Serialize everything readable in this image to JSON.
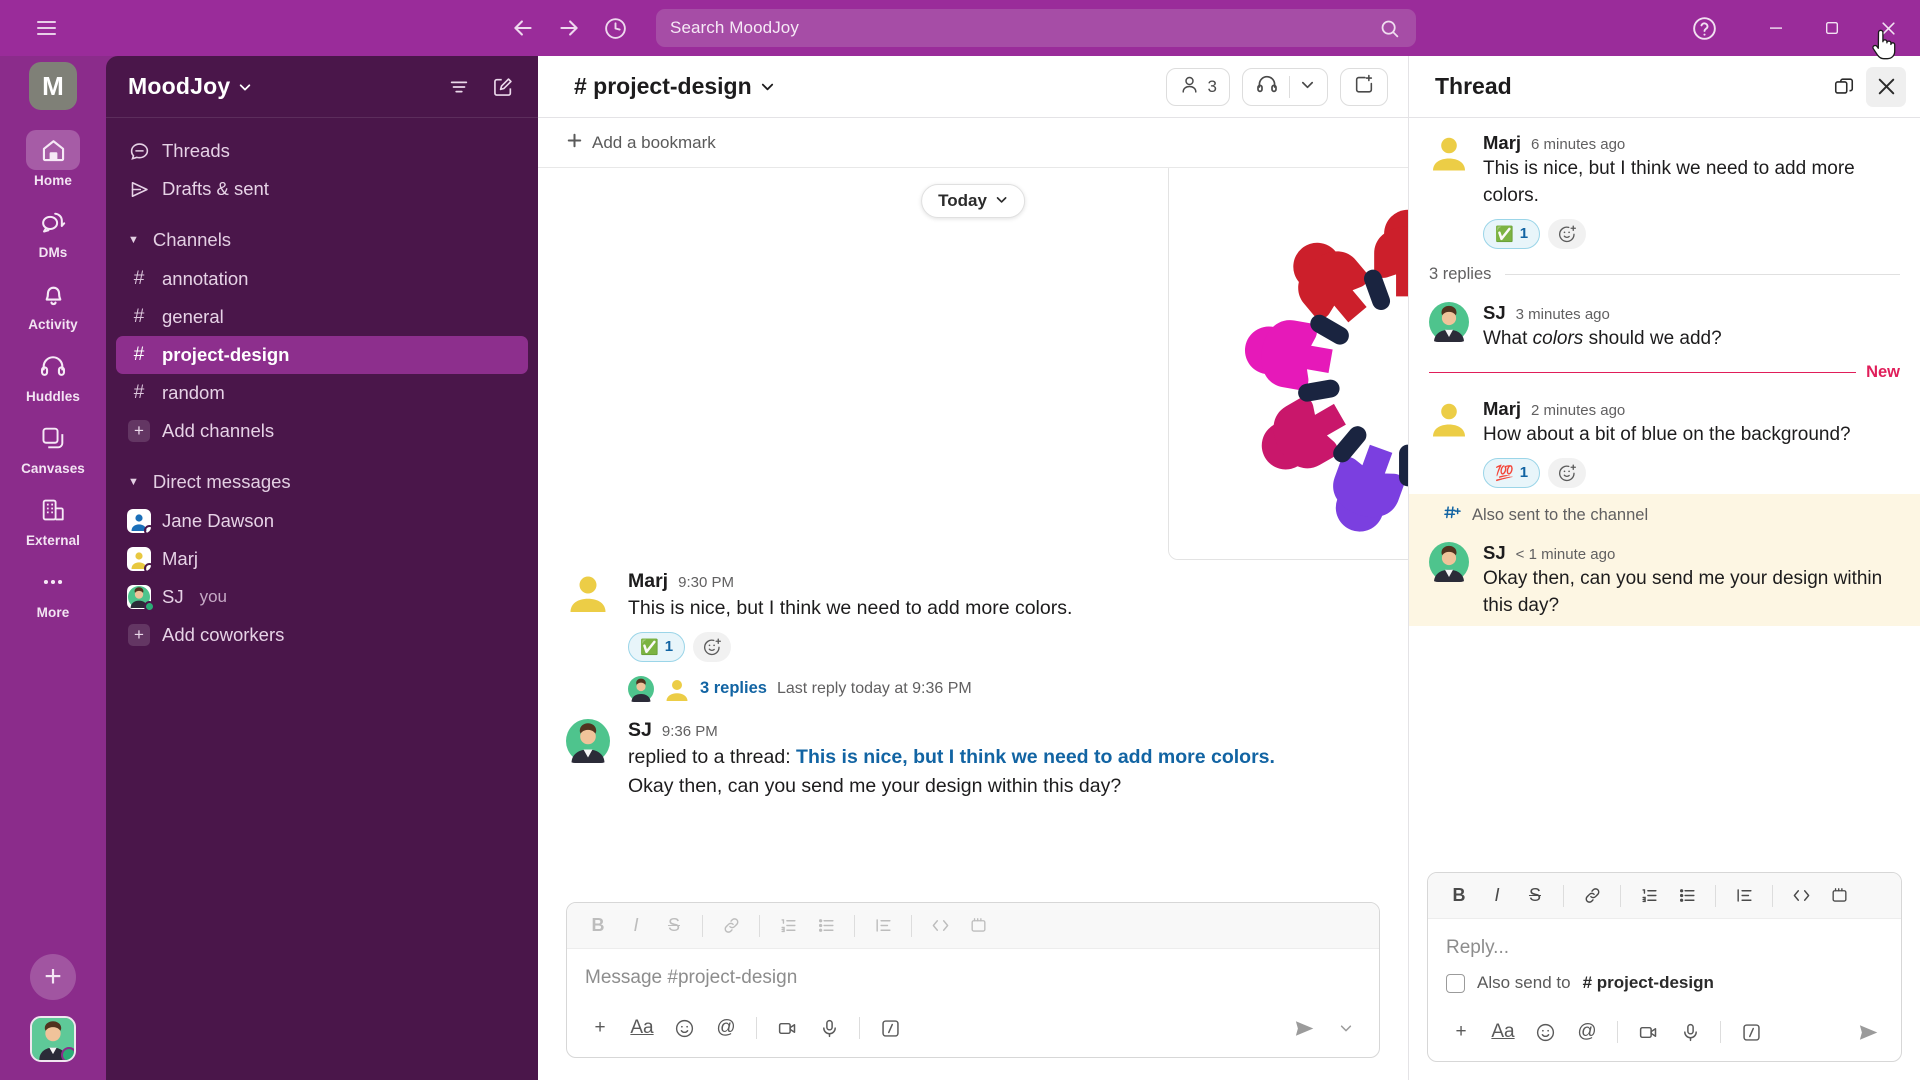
{
  "titlebar": {
    "hamburger_icon": "hamburger-menu-icon",
    "back_icon": "arrow-back-icon",
    "forward_icon": "arrow-forward-icon",
    "history_icon": "clock-history-icon",
    "search_placeholder": "Search MoodJoy",
    "search_icon": "search-magnifier-icon",
    "help_icon": "help-circle-icon",
    "minimize_icon": "window-minimize-icon",
    "maximize_icon": "window-maximize-icon",
    "close_icon": "window-close-icon"
  },
  "rail": {
    "workspace_initial": "M",
    "items": [
      {
        "label": "Home",
        "icon": "home-icon",
        "active": true
      },
      {
        "label": "DMs",
        "icon": "dms-bubble-icon",
        "active": false
      },
      {
        "label": "Activity",
        "icon": "bell-icon",
        "active": false
      },
      {
        "label": "Huddles",
        "icon": "headphones-icon",
        "active": false
      },
      {
        "label": "Canvases",
        "icon": "canvas-pages-icon",
        "active": false
      },
      {
        "label": "External",
        "icon": "building-icon",
        "active": false
      },
      {
        "label": "More",
        "icon": "ellipsis-icon",
        "active": false
      }
    ],
    "new_button_icon": "plus-icon",
    "avatar_name": "user-avatar"
  },
  "sidebar": {
    "workspace_name": "MoodJoy",
    "workspace_caret_icon": "chevron-down-icon",
    "filter_icon": "filter-lines-icon",
    "compose_icon": "compose-pencil-icon",
    "top_items": [
      {
        "label": "Threads",
        "icon": "threads-bubble-icon"
      },
      {
        "label": "Drafts & sent",
        "icon": "paper-plane-icon"
      }
    ],
    "channels_section": {
      "label": "Channels",
      "caret_icon": "caret-down-icon",
      "items": [
        {
          "label": "annotation",
          "active": false
        },
        {
          "label": "general",
          "active": false
        },
        {
          "label": "project-design",
          "active": true
        },
        {
          "label": "random",
          "active": false
        }
      ],
      "add_label": "Add channels",
      "add_icon": "plus-icon"
    },
    "dm_section": {
      "label": "Direct messages",
      "caret_icon": "caret-down-icon",
      "items": [
        {
          "label": "Jane Dawson",
          "suffix": "",
          "presence": "offline",
          "avatar_color": "#1b6fb8"
        },
        {
          "label": "Marj",
          "suffix": "",
          "presence": "offline",
          "avatar_color": "#e8c840"
        },
        {
          "label": "SJ",
          "suffix": "you",
          "presence": "online",
          "avatar_color": "#4ec48d"
        }
      ],
      "add_label": "Add coworkers",
      "add_icon": "plus-icon"
    }
  },
  "channel": {
    "name": "# project-design",
    "caret_icon": "chevron-down-icon",
    "members_count": "3",
    "members_icon": "person-icon",
    "huddle_icon": "headphones-icon",
    "huddle_caret_icon": "chevron-down-icon",
    "new_canvas_icon": "add-canvas-icon",
    "bookmark_label": "Add a bookmark",
    "bookmark_icon": "plus-icon",
    "date_chip": "Today",
    "date_chip_caret_icon": "chevron-down-icon",
    "attachment_alt": "circle-of-colorful-people-illustration",
    "messages": [
      {
        "author": "Marj",
        "time": "9:30 PM",
        "avatar_color": "#e8c840",
        "text": "This is nice, but I think we need to add more colors.",
        "reaction_emoji": "✅",
        "reaction_count": "1",
        "add_reaction_icon": "add-reaction-icon",
        "thread_count": "3 replies",
        "thread_last": "Last reply today at 9:36 PM"
      },
      {
        "author": "SJ",
        "time": "9:36 PM",
        "avatar_color": "#4ec48d",
        "reply_prefix": "replied to a thread:",
        "reply_quote": "This is nice, but I think we need to add more colors.",
        "text": "Okay then, can you send me your design within this day?"
      }
    ],
    "composer": {
      "placeholder": "Message #project-design",
      "format_tools": [
        {
          "icon": "bold-icon",
          "glyph": "B"
        },
        {
          "icon": "italic-icon",
          "glyph": "I"
        },
        {
          "icon": "strikethrough-icon",
          "glyph": "S"
        },
        {
          "icon": "link-icon",
          "glyph": "🔗"
        },
        {
          "icon": "ordered-list-icon",
          "glyph": ""
        },
        {
          "icon": "bulleted-list-icon",
          "glyph": ""
        },
        {
          "icon": "blockquote-icon",
          "glyph": ""
        },
        {
          "icon": "code-icon",
          "glyph": "</>"
        },
        {
          "icon": "code-block-icon",
          "glyph": ""
        }
      ],
      "actions": [
        {
          "icon": "plus-icon",
          "glyph": "+"
        },
        {
          "icon": "text-format-icon",
          "glyph": "Aa"
        },
        {
          "icon": "emoji-icon",
          "glyph": "☺"
        },
        {
          "icon": "mention-icon",
          "glyph": "@"
        },
        {
          "icon": "video-icon",
          "glyph": ""
        },
        {
          "icon": "microphone-icon",
          "glyph": ""
        },
        {
          "icon": "slash-command-icon",
          "glyph": ""
        }
      ],
      "send_icon": "send-plane-icon",
      "send_options_icon": "chevron-down-icon"
    }
  },
  "thread": {
    "title": "Thread",
    "expand_icon": "open-in-split-view-icon",
    "close_icon": "close-x-icon",
    "root": {
      "author": "Marj",
      "time": "6 minutes ago",
      "avatar_color": "#e8c840",
      "text": "This is nice, but I think we need to add more colors.",
      "reaction_emoji": "✅",
      "reaction_count": "1",
      "add_reaction_icon": "add-reaction-icon"
    },
    "replies_label": "3 replies",
    "new_divider_label": "New",
    "replies": [
      {
        "author": "SJ",
        "time": "3 minutes ago",
        "avatar_color": "#4ec48d",
        "text_before": "What ",
        "text_italic": "colors",
        "text_after": " should we add?",
        "highlight": false
      },
      {
        "author": "Marj",
        "time": "2 minutes ago",
        "avatar_color": "#e8c840",
        "text": "How about a bit of blue on the background?",
        "reaction_emoji": "💯",
        "reaction_count": "1",
        "add_reaction_icon": "add-reaction-icon",
        "highlight": false
      },
      {
        "author": "SJ",
        "time": "< 1 minute ago",
        "avatar_color": "#4ec48d",
        "text": "Okay then, can you send me your design within this day?",
        "highlight": true,
        "also_sent_label": "Also sent to the channel",
        "also_sent_icon": "channel-share-icon"
      }
    ],
    "composer": {
      "placeholder": "Reply...",
      "also_send_prefix": "Also send to",
      "also_send_channel": "# project-design",
      "checkbox_icon": "checkbox-unchecked-icon",
      "format_tools": [
        {
          "icon": "bold-icon",
          "glyph": "B"
        },
        {
          "icon": "italic-icon",
          "glyph": "I"
        },
        {
          "icon": "strikethrough-icon",
          "glyph": "S"
        },
        {
          "icon": "link-icon",
          "glyph": ""
        },
        {
          "icon": "ordered-list-icon",
          "glyph": ""
        },
        {
          "icon": "bulleted-list-icon",
          "glyph": ""
        },
        {
          "icon": "blockquote-icon",
          "glyph": ""
        },
        {
          "icon": "code-icon",
          "glyph": "</>"
        },
        {
          "icon": "code-block-icon",
          "glyph": ""
        }
      ],
      "actions": [
        {
          "icon": "plus-icon",
          "glyph": "+"
        },
        {
          "icon": "text-format-icon",
          "glyph": "Aa"
        },
        {
          "icon": "emoji-icon",
          "glyph": "☺"
        },
        {
          "icon": "mention-icon",
          "glyph": "@"
        },
        {
          "icon": "video-icon",
          "glyph": ""
        },
        {
          "icon": "microphone-icon",
          "glyph": ""
        },
        {
          "icon": "slash-command-icon",
          "glyph": ""
        }
      ],
      "send_icon": "send-plane-icon"
    }
  },
  "colors": {
    "brand_purple": "#8B2C8B",
    "topbar_purple": "#9A2C9A",
    "sidebar_purple": "#4A164A",
    "active_channel": "#8D2F8D",
    "link_blue": "#1264A3",
    "new_red": "#E01E5A",
    "highlight_cream": "#FDF6E3"
  }
}
